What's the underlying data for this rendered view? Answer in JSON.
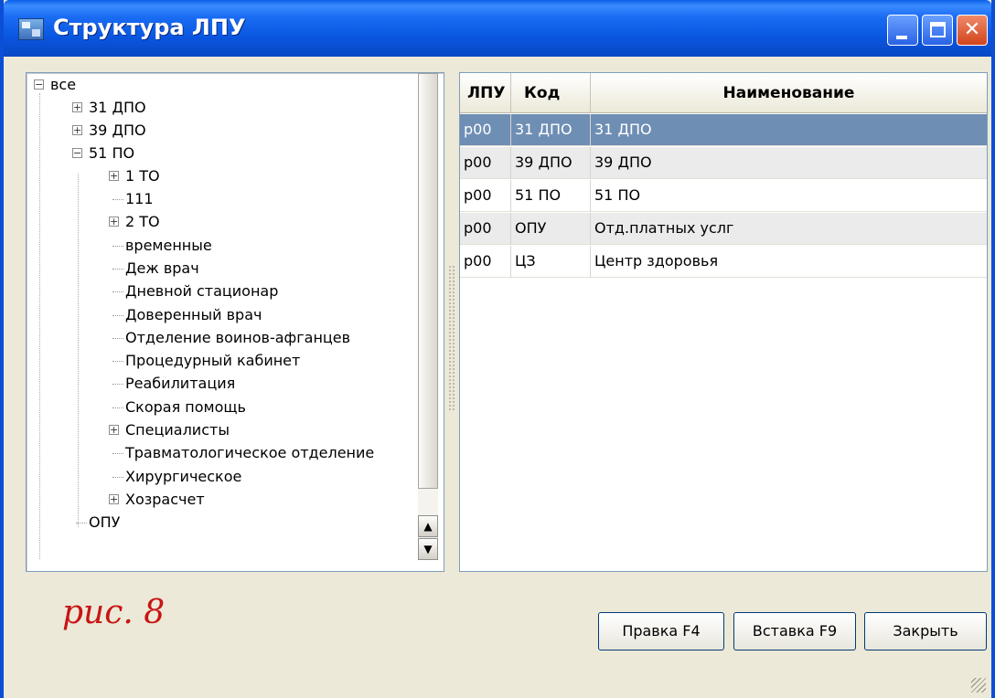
{
  "window": {
    "title": "Структура ЛПУ",
    "accent_color": "#0a56e0",
    "icons": [
      "app-structure-icon",
      "minimize-icon",
      "maximize-icon",
      "close-icon"
    ]
  },
  "tree": {
    "items": [
      {
        "label": "все",
        "expanded": true
      },
      {
        "label": "31 ДПО",
        "expanded": false
      },
      {
        "label": "39 ДПО",
        "expanded": false
      },
      {
        "label": "51 ПО",
        "expanded": true
      },
      {
        "label": "1 ТО",
        "expanded": false
      },
      {
        "label": "111"
      },
      {
        "label": "2 ТО",
        "expanded": false
      },
      {
        "label": "временные"
      },
      {
        "label": "Деж врач"
      },
      {
        "label": "Дневной стационар"
      },
      {
        "label": "Доверенный врач"
      },
      {
        "label": "Отделение воинов-афганцев"
      },
      {
        "label": "Процедурный кабинет"
      },
      {
        "label": "Реабилитация"
      },
      {
        "label": "Скорая помощь"
      },
      {
        "label": "Специалисты",
        "expanded": false
      },
      {
        "label": "Травматологическое отделение"
      },
      {
        "label": "Хирургическое"
      },
      {
        "label": "Хозрасчет",
        "expanded": false
      },
      {
        "label": "ОПУ"
      }
    ]
  },
  "grid": {
    "columns": [
      "ЛПУ",
      "Код",
      "Наименование"
    ],
    "rows": [
      [
        "р00",
        "31 ДПО",
        "31 ДПО"
      ],
      [
        "р00",
        "39 ДПО",
        "39 ДПО"
      ],
      [
        "р00",
        "51 ПО",
        "51 ПО"
      ],
      [
        "р00",
        "ОПУ",
        "Отд.платных услг"
      ],
      [
        "р00",
        "ЦЗ",
        "Центр здоровья"
      ]
    ],
    "selected_row": 0,
    "selected_color": "#6f8eb4"
  },
  "caption": "рис. 8",
  "caption_color": "#c81414",
  "buttons": {
    "edit": "Правка F4",
    "insert": "Вставка F9",
    "close": "Закрыть"
  }
}
